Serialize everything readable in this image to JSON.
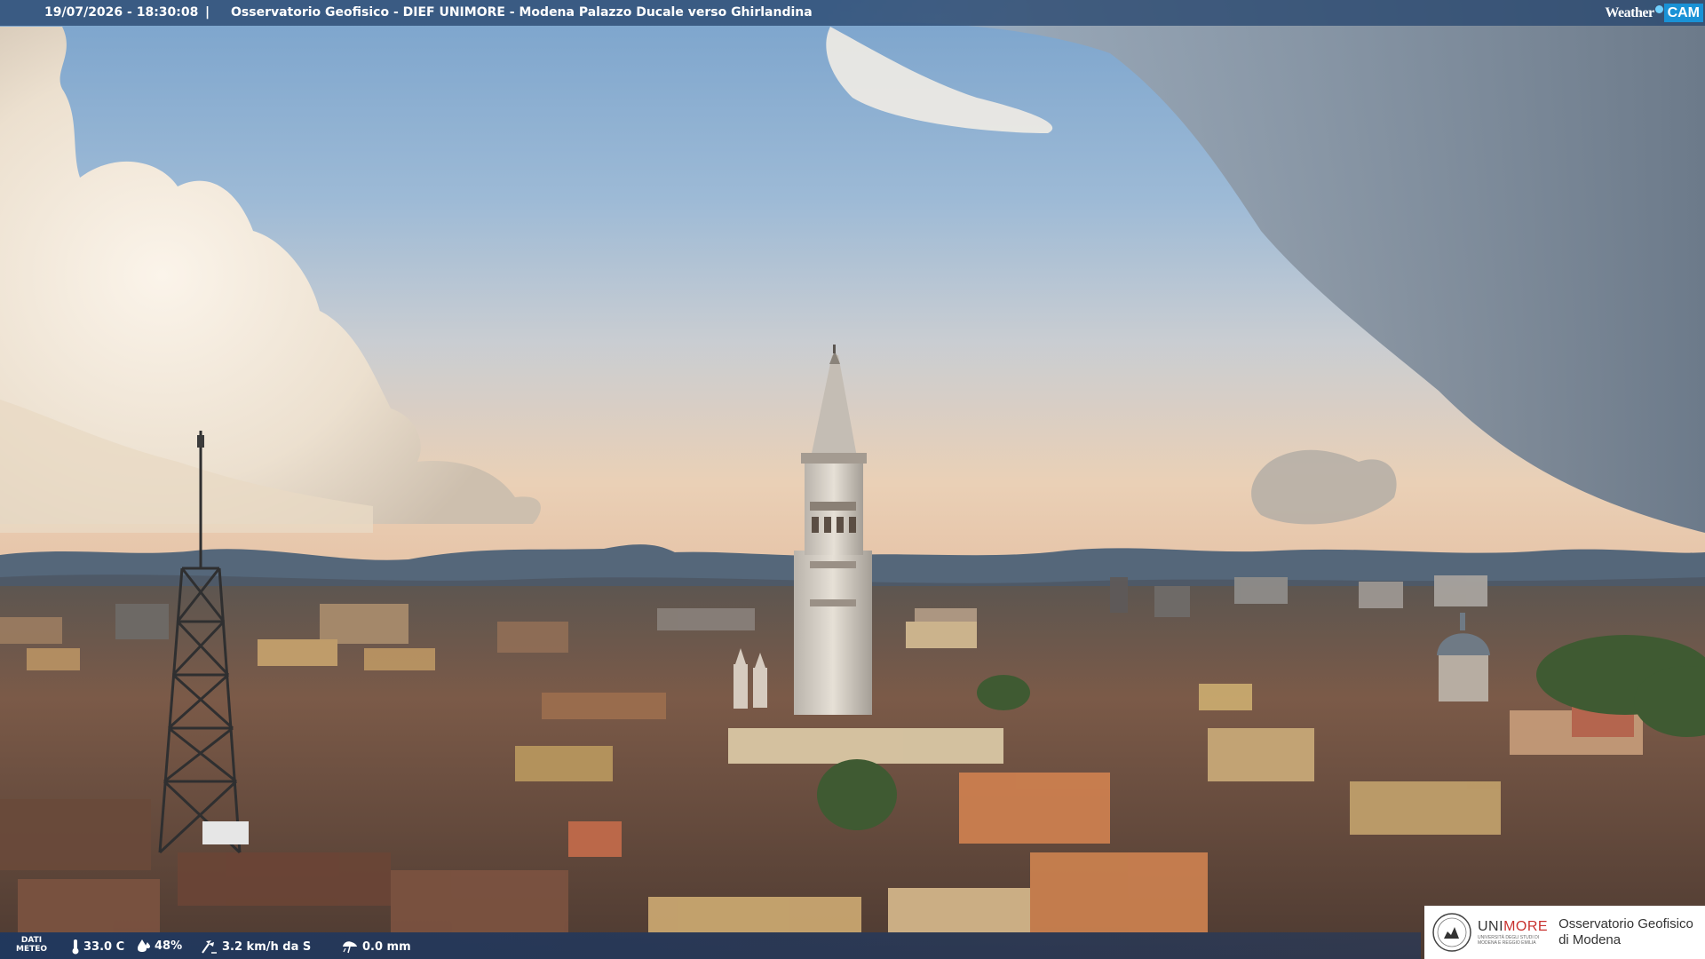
{
  "header": {
    "timestamp": "19/07/2026 - 18:30:08",
    "separator": "|",
    "title": "Osservatorio Geofisico - DIEF UNIMORE - Modena Palazzo Ducale verso Ghirlandina",
    "brand_weather": "Weather",
    "brand_cam": "CAM"
  },
  "weather": {
    "label_line1": "DATI",
    "label_line2": "METEO",
    "temperature": "33.0 C",
    "humidity": "48%",
    "wind": "3.2 km/h da S",
    "rain": "0.0 mm",
    "icons": [
      "thermometer-icon",
      "humidity-drop-icon",
      "wind-icon",
      "rain-icon"
    ]
  },
  "logo": {
    "uni_prefix": "UNI",
    "uni_suffix": "MORE",
    "uni_subtitle_line1": "UNIVERSITÀ DEGLI STUDI DI",
    "uni_subtitle_line2": "MODENA E REGGIO EMILIA",
    "observatory_line1": "Osservatorio Geofisico",
    "observatory_line2": "di Modena"
  },
  "colors": {
    "topbar": "#284670",
    "brand_cam": "#1a92d6",
    "unimore_red": "#c8322f",
    "sky_top": "#7fa6cc",
    "sky_horizon": "#e9c9ae",
    "storm_cloud": "#7d8a99",
    "roofs": "#8a5a45"
  }
}
